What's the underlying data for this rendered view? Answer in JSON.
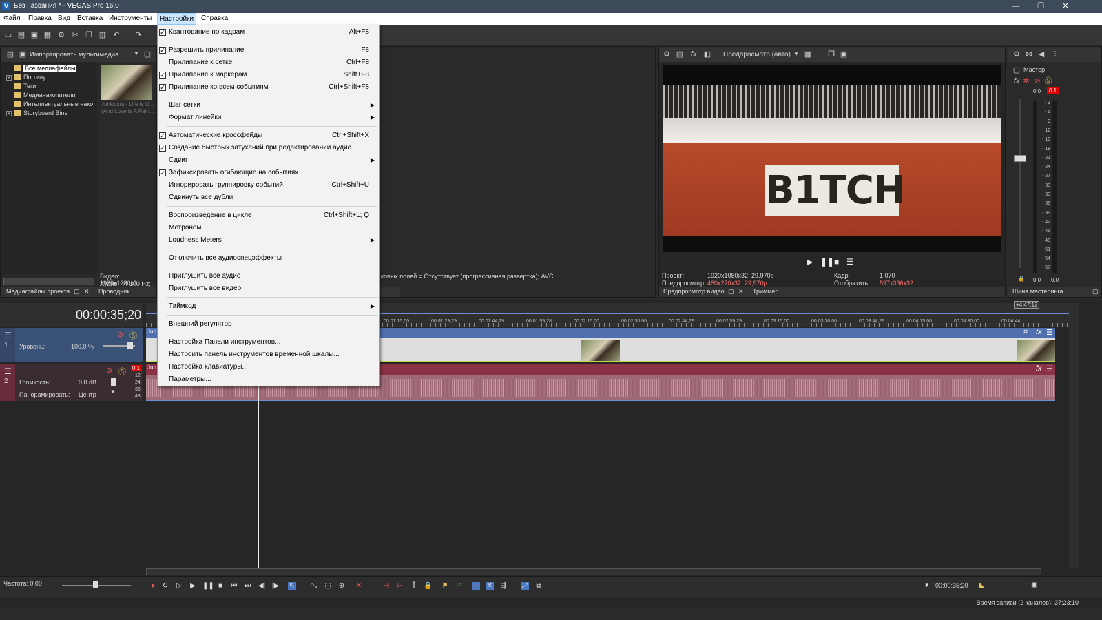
{
  "window": {
    "title": "Без названия * - VEGAS Pro 16.0",
    "logo": "V",
    "minimize": "—",
    "maximize": "❐",
    "close": "✕"
  },
  "menu": {
    "items": [
      "Файл",
      "Правка",
      "Вид",
      "Вставка",
      "Инструменты",
      "Настройки",
      "Справка"
    ],
    "active": "Настройки"
  },
  "explorer": {
    "import_label": "Импортировать мультимедиа...",
    "tree": [
      "Все медиафайлы",
      "По типу",
      "Теги",
      "Медианакопители",
      "Интеллектуальные нако",
      "Storyboard Bins"
    ],
    "thumb_caption": "Junksista - Life Is U... (And Love Is A Pain...",
    "video_info": "Видео: 1920x1080x3",
    "audio_info": "Аудио: 44 100 Hz; S",
    "props_text": "ковых полей = Отсутствует (прогрессивная развертка); AVC",
    "tabs": [
      "Медиафайлы проекта",
      "Проводник"
    ]
  },
  "settings_menu": [
    {
      "label": "Квантование по кадрам",
      "shortcut": "Alt+F8",
      "checked": true,
      "submenu": false
    },
    {
      "label": "Разрешить прилипание",
      "shortcut": "F8",
      "checked": true,
      "submenu": false
    },
    {
      "label": "Прилипание к сетке",
      "shortcut": "Ctrl+F8",
      "checked": false,
      "submenu": false
    },
    {
      "label": "Прилипание к маркерам",
      "shortcut": "Shift+F8",
      "checked": true,
      "submenu": false
    },
    {
      "label": "Прилипание ко всем событиям",
      "shortcut": "Ctrl+Shift+F8",
      "checked": true,
      "submenu": false
    },
    {
      "label": "Шаг сетки",
      "shortcut": "",
      "checked": false,
      "submenu": true
    },
    {
      "label": "Формат линейки",
      "shortcut": "",
      "checked": false,
      "submenu": true
    },
    {
      "label": "Автоматические кроссфейды",
      "shortcut": "Ctrl+Shift+X",
      "checked": true,
      "submenu": false
    },
    {
      "label": "Создание быстрых затуханий при редактировании аудио",
      "shortcut": "",
      "checked": true,
      "submenu": false
    },
    {
      "label": "Сдвиг",
      "shortcut": "",
      "checked": false,
      "submenu": true
    },
    {
      "label": "Зафиксировать огибающие на событиях",
      "shortcut": "",
      "checked": true,
      "submenu": false
    },
    {
      "label": "Игнорировать группировку событий",
      "shortcut": "Ctrl+Shift+U",
      "checked": false,
      "submenu": false
    },
    {
      "label": "Сдвинуть все дубли",
      "shortcut": "",
      "checked": false,
      "submenu": false
    },
    {
      "label": "Воспроизведение в цикле",
      "shortcut": "Ctrl+Shift+L; Q",
      "checked": false,
      "submenu": false
    },
    {
      "label": "Метроном",
      "shortcut": "",
      "checked": false,
      "submenu": false
    },
    {
      "label": "Loudness Meters",
      "shortcut": "",
      "checked": false,
      "submenu": true
    },
    {
      "label": "Отключить все аудиоспецэффекты",
      "shortcut": "",
      "checked": false,
      "submenu": false
    },
    {
      "label": "Приглушить все аудио",
      "shortcut": "",
      "checked": false,
      "submenu": false
    },
    {
      "label": "Приглушить все видео",
      "shortcut": "",
      "checked": false,
      "submenu": false
    },
    {
      "label": "Таймкод",
      "shortcut": "",
      "checked": false,
      "submenu": true
    },
    {
      "label": "Внешний регулятор",
      "shortcut": "",
      "checked": false,
      "submenu": false
    },
    {
      "label": "Настройка Панели инструментов...",
      "shortcut": "",
      "checked": false,
      "submenu": false
    },
    {
      "label": "Настроить панель инструментов временной шкалы...",
      "shortcut": "",
      "checked": false,
      "submenu": false
    },
    {
      "label": "Настройка клавиатуры...",
      "shortcut": "",
      "checked": false,
      "submenu": false
    },
    {
      "label": "Параметры...",
      "shortcut": "",
      "checked": false,
      "submenu": false
    }
  ],
  "preview": {
    "mode": "Предпросмотр (авто)",
    "plate_text": "B1TCH",
    "project_label": "Проект:",
    "project_val": "1920x1080x32; 29,970p",
    "preview_label": "Предпросмотр:",
    "preview_val": "480x270x32; 29,970p",
    "frame_label": "Кадр:",
    "frame_val": "1 070",
    "display_label": "Отобразить:",
    "display_val": "597x336x32",
    "tabs": [
      "Предпросмотр видео",
      "Триммер"
    ]
  },
  "master": {
    "title": "Мастер",
    "left_peak": "0.0",
    "right_peak": "0.1",
    "bottom_left": "0.0",
    "bottom_right": "0.0",
    "tab": "Шина мастеринга",
    "scale": [
      "3",
      "6",
      "9",
      "12",
      "15",
      "18",
      "21",
      "24",
      "27",
      "30",
      "33",
      "36",
      "39",
      "42",
      "45",
      "48",
      "51",
      "54",
      "57"
    ]
  },
  "timeline": {
    "timecode": "00:00:35;20",
    "end_marker": "+4:47;12",
    "ruler": [
      "00:01:15;00",
      "00:01:29;29",
      "00:01:44;29",
      "00:01:59;28",
      "00:02:15;00",
      "00:02:30;00",
      "00:02:44;29",
      "00:02:59;29",
      "00:03:15;00",
      "00:03:30;00",
      "00:03:44;29",
      "00:04:15;00",
      "00:04:30;00",
      "00:04:44"
    ],
    "clip_label": "Jun",
    "tracks": [
      {
        "number": "1",
        "param_label": "Уровень:",
        "param_value": "100,0 %"
      },
      {
        "number": "2",
        "param_label": "Громкость:",
        "param_value": "0,0 dB",
        "pan_label": "Панорамировать:",
        "pan_value": "Центр",
        "peak": "0.1",
        "db_scale": [
          "12",
          "24",
          "36",
          "48"
        ]
      }
    ]
  },
  "footer": {
    "rate_label": "Частота: 0,00",
    "cursor_time": "00:00:35;20",
    "record_info": "Время записи (2 каналов): 37:23:10"
  }
}
